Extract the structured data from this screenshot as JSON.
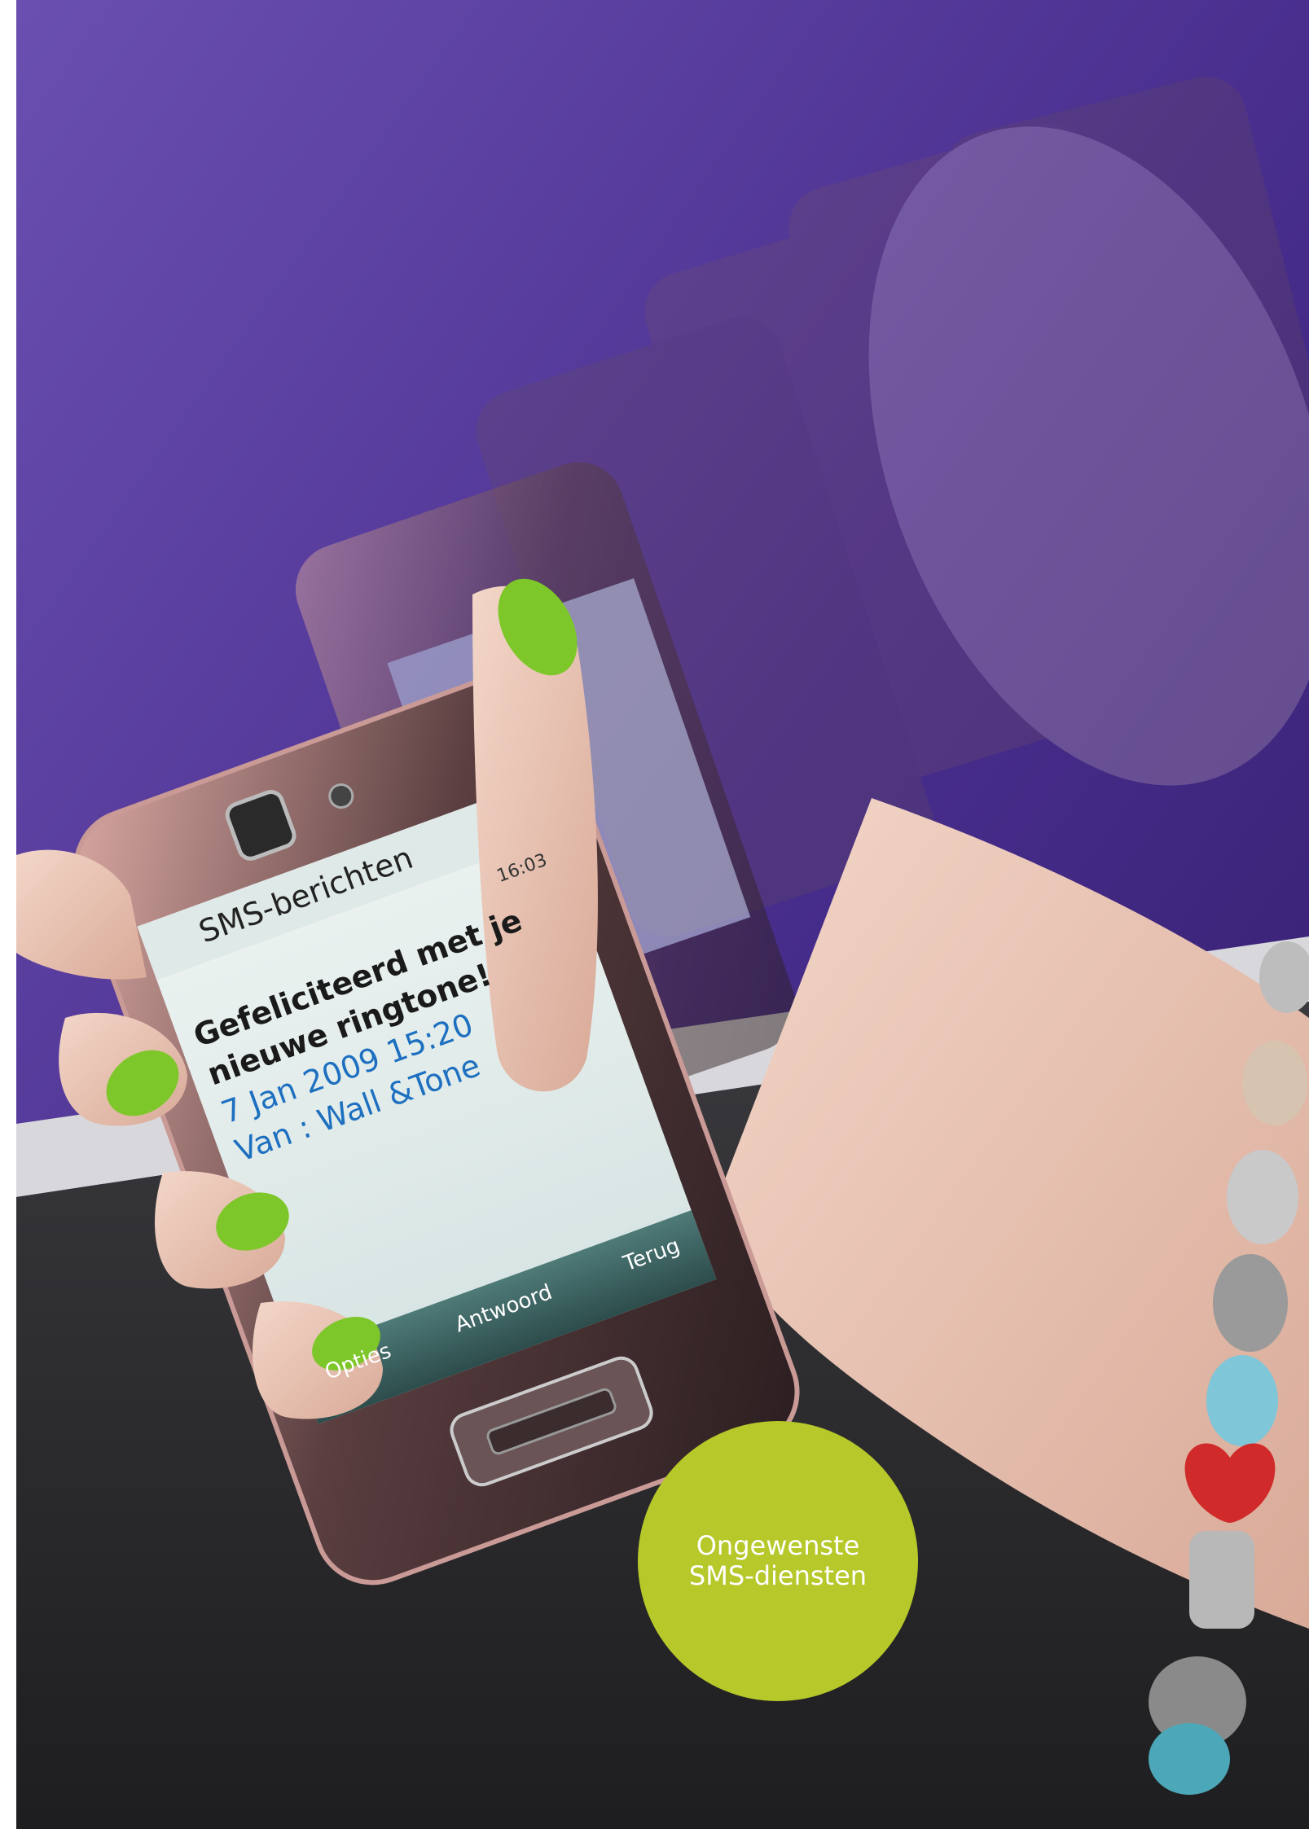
{
  "phone_screen": {
    "header_title": "SMS-berichten",
    "status_time": "16:03",
    "message_line1": "Gefeliciteerd met je",
    "message_line2": "nieuwe ringtone!",
    "message_date": "7 Jan 2009 15:20",
    "message_sender": "Van : Wall &Tone",
    "softkey_left": "Opties",
    "softkey_middle": "Antwoord",
    "softkey_right": "Terug"
  },
  "badge": {
    "line1": "Ongewenste",
    "line2": "SMS-diensten"
  },
  "colors": {
    "badge_green": "#b6c82a",
    "wall_purple": "#4a2f8f",
    "floor_dark": "#2a2a2c",
    "nail_green": "#7ec72a",
    "message_blue": "#1d6fc0"
  }
}
